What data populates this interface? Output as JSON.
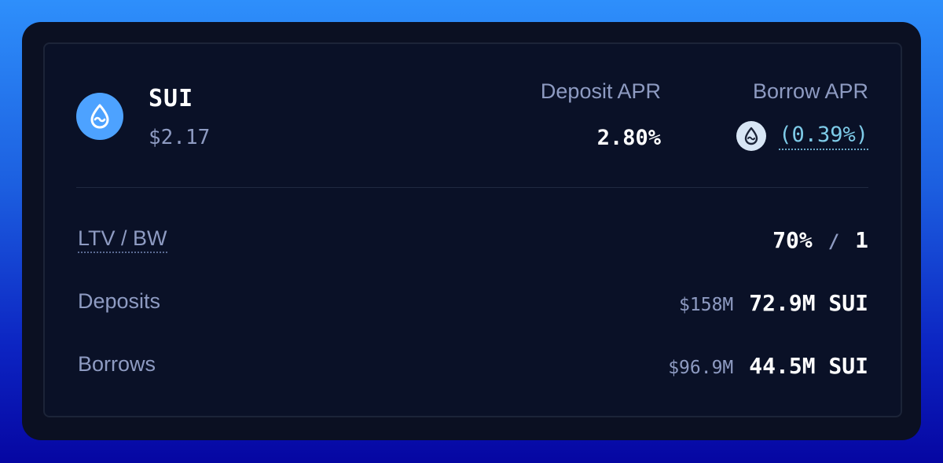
{
  "asset": {
    "symbol": "SUI",
    "price": "$2.17",
    "icon": "sui-droplet-icon",
    "brand_color": "#4da2ff"
  },
  "header": {
    "deposit_apr_label": "Deposit APR",
    "deposit_apr_value": "2.80%",
    "borrow_apr_label": "Borrow APR",
    "borrow_apr_value": "(0.39%)",
    "borrow_reward_icon": "sui-droplet-icon"
  },
  "stats": {
    "ltv_bw": {
      "label": "LTV / BW",
      "ltv": "70%",
      "separator": "/",
      "bw": "1"
    },
    "deposits": {
      "label": "Deposits",
      "usd": "$158M",
      "amount": "72.9M SUI"
    },
    "borrows": {
      "label": "Borrows",
      "usd": "$96.9M",
      "amount": "44.5M SUI"
    }
  },
  "colors": {
    "card_background": "#0a1127",
    "muted_text": "#8e9bc2",
    "apr_accent": "#7ecbe8"
  }
}
